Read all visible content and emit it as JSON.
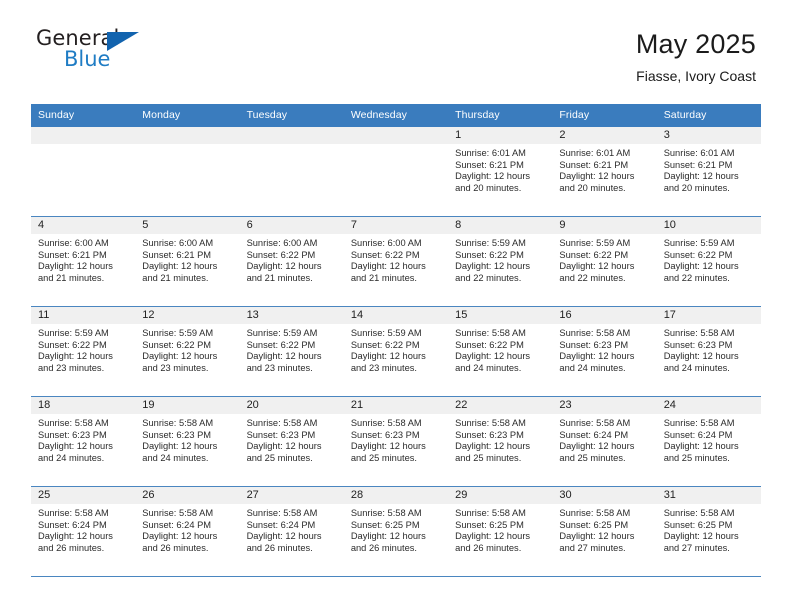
{
  "brand": {
    "name_part1": "General",
    "name_part2": "Blue",
    "accent_color": "#1f7cc4",
    "triangle_color": "#1263ae"
  },
  "header": {
    "title": "May 2025",
    "subtitle": "Fiasse, Ivory Coast"
  },
  "theme": {
    "header_row_background": "#3a7cbe",
    "header_row_text": "#ffffff",
    "daynum_band_background": "#f0f0f0",
    "row_separator": "#4a86c0",
    "cell_background": "#ffffff",
    "body_text": "#2b2b2b"
  },
  "weekday_headers": [
    "Sunday",
    "Monday",
    "Tuesday",
    "Wednesday",
    "Thursday",
    "Friday",
    "Saturday"
  ],
  "weeks": [
    [
      {
        "day": "",
        "blank": true
      },
      {
        "day": "",
        "blank": true
      },
      {
        "day": "",
        "blank": true
      },
      {
        "day": "",
        "blank": true
      },
      {
        "day": "1",
        "sunrise": "Sunrise: 6:01 AM",
        "sunset": "Sunset: 6:21 PM",
        "daylight_line1": "Daylight: 12 hours",
        "daylight_line2": "and 20 minutes."
      },
      {
        "day": "2",
        "sunrise": "Sunrise: 6:01 AM",
        "sunset": "Sunset: 6:21 PM",
        "daylight_line1": "Daylight: 12 hours",
        "daylight_line2": "and 20 minutes."
      },
      {
        "day": "3",
        "sunrise": "Sunrise: 6:01 AM",
        "sunset": "Sunset: 6:21 PM",
        "daylight_line1": "Daylight: 12 hours",
        "daylight_line2": "and 20 minutes."
      }
    ],
    [
      {
        "day": "4",
        "sunrise": "Sunrise: 6:00 AM",
        "sunset": "Sunset: 6:21 PM",
        "daylight_line1": "Daylight: 12 hours",
        "daylight_line2": "and 21 minutes."
      },
      {
        "day": "5",
        "sunrise": "Sunrise: 6:00 AM",
        "sunset": "Sunset: 6:21 PM",
        "daylight_line1": "Daylight: 12 hours",
        "daylight_line2": "and 21 minutes."
      },
      {
        "day": "6",
        "sunrise": "Sunrise: 6:00 AM",
        "sunset": "Sunset: 6:22 PM",
        "daylight_line1": "Daylight: 12 hours",
        "daylight_line2": "and 21 minutes."
      },
      {
        "day": "7",
        "sunrise": "Sunrise: 6:00 AM",
        "sunset": "Sunset: 6:22 PM",
        "daylight_line1": "Daylight: 12 hours",
        "daylight_line2": "and 21 minutes."
      },
      {
        "day": "8",
        "sunrise": "Sunrise: 5:59 AM",
        "sunset": "Sunset: 6:22 PM",
        "daylight_line1": "Daylight: 12 hours",
        "daylight_line2": "and 22 minutes."
      },
      {
        "day": "9",
        "sunrise": "Sunrise: 5:59 AM",
        "sunset": "Sunset: 6:22 PM",
        "daylight_line1": "Daylight: 12 hours",
        "daylight_line2": "and 22 minutes."
      },
      {
        "day": "10",
        "sunrise": "Sunrise: 5:59 AM",
        "sunset": "Sunset: 6:22 PM",
        "daylight_line1": "Daylight: 12 hours",
        "daylight_line2": "and 22 minutes."
      }
    ],
    [
      {
        "day": "11",
        "sunrise": "Sunrise: 5:59 AM",
        "sunset": "Sunset: 6:22 PM",
        "daylight_line1": "Daylight: 12 hours",
        "daylight_line2": "and 23 minutes."
      },
      {
        "day": "12",
        "sunrise": "Sunrise: 5:59 AM",
        "sunset": "Sunset: 6:22 PM",
        "daylight_line1": "Daylight: 12 hours",
        "daylight_line2": "and 23 minutes."
      },
      {
        "day": "13",
        "sunrise": "Sunrise: 5:59 AM",
        "sunset": "Sunset: 6:22 PM",
        "daylight_line1": "Daylight: 12 hours",
        "daylight_line2": "and 23 minutes."
      },
      {
        "day": "14",
        "sunrise": "Sunrise: 5:59 AM",
        "sunset": "Sunset: 6:22 PM",
        "daylight_line1": "Daylight: 12 hours",
        "daylight_line2": "and 23 minutes."
      },
      {
        "day": "15",
        "sunrise": "Sunrise: 5:58 AM",
        "sunset": "Sunset: 6:22 PM",
        "daylight_line1": "Daylight: 12 hours",
        "daylight_line2": "and 24 minutes."
      },
      {
        "day": "16",
        "sunrise": "Sunrise: 5:58 AM",
        "sunset": "Sunset: 6:23 PM",
        "daylight_line1": "Daylight: 12 hours",
        "daylight_line2": "and 24 minutes."
      },
      {
        "day": "17",
        "sunrise": "Sunrise: 5:58 AM",
        "sunset": "Sunset: 6:23 PM",
        "daylight_line1": "Daylight: 12 hours",
        "daylight_line2": "and 24 minutes."
      }
    ],
    [
      {
        "day": "18",
        "sunrise": "Sunrise: 5:58 AM",
        "sunset": "Sunset: 6:23 PM",
        "daylight_line1": "Daylight: 12 hours",
        "daylight_line2": "and 24 minutes."
      },
      {
        "day": "19",
        "sunrise": "Sunrise: 5:58 AM",
        "sunset": "Sunset: 6:23 PM",
        "daylight_line1": "Daylight: 12 hours",
        "daylight_line2": "and 24 minutes."
      },
      {
        "day": "20",
        "sunrise": "Sunrise: 5:58 AM",
        "sunset": "Sunset: 6:23 PM",
        "daylight_line1": "Daylight: 12 hours",
        "daylight_line2": "and 25 minutes."
      },
      {
        "day": "21",
        "sunrise": "Sunrise: 5:58 AM",
        "sunset": "Sunset: 6:23 PM",
        "daylight_line1": "Daylight: 12 hours",
        "daylight_line2": "and 25 minutes."
      },
      {
        "day": "22",
        "sunrise": "Sunrise: 5:58 AM",
        "sunset": "Sunset: 6:23 PM",
        "daylight_line1": "Daylight: 12 hours",
        "daylight_line2": "and 25 minutes."
      },
      {
        "day": "23",
        "sunrise": "Sunrise: 5:58 AM",
        "sunset": "Sunset: 6:24 PM",
        "daylight_line1": "Daylight: 12 hours",
        "daylight_line2": "and 25 minutes."
      },
      {
        "day": "24",
        "sunrise": "Sunrise: 5:58 AM",
        "sunset": "Sunset: 6:24 PM",
        "daylight_line1": "Daylight: 12 hours",
        "daylight_line2": "and 25 minutes."
      }
    ],
    [
      {
        "day": "25",
        "sunrise": "Sunrise: 5:58 AM",
        "sunset": "Sunset: 6:24 PM",
        "daylight_line1": "Daylight: 12 hours",
        "daylight_line2": "and 26 minutes."
      },
      {
        "day": "26",
        "sunrise": "Sunrise: 5:58 AM",
        "sunset": "Sunset: 6:24 PM",
        "daylight_line1": "Daylight: 12 hours",
        "daylight_line2": "and 26 minutes."
      },
      {
        "day": "27",
        "sunrise": "Sunrise: 5:58 AM",
        "sunset": "Sunset: 6:24 PM",
        "daylight_line1": "Daylight: 12 hours",
        "daylight_line2": "and 26 minutes."
      },
      {
        "day": "28",
        "sunrise": "Sunrise: 5:58 AM",
        "sunset": "Sunset: 6:25 PM",
        "daylight_line1": "Daylight: 12 hours",
        "daylight_line2": "and 26 minutes."
      },
      {
        "day": "29",
        "sunrise": "Sunrise: 5:58 AM",
        "sunset": "Sunset: 6:25 PM",
        "daylight_line1": "Daylight: 12 hours",
        "daylight_line2": "and 26 minutes."
      },
      {
        "day": "30",
        "sunrise": "Sunrise: 5:58 AM",
        "sunset": "Sunset: 6:25 PM",
        "daylight_line1": "Daylight: 12 hours",
        "daylight_line2": "and 27 minutes."
      },
      {
        "day": "31",
        "sunrise": "Sunrise: 5:58 AM",
        "sunset": "Sunset: 6:25 PM",
        "daylight_line1": "Daylight: 12 hours",
        "daylight_line2": "and 27 minutes."
      }
    ]
  ]
}
